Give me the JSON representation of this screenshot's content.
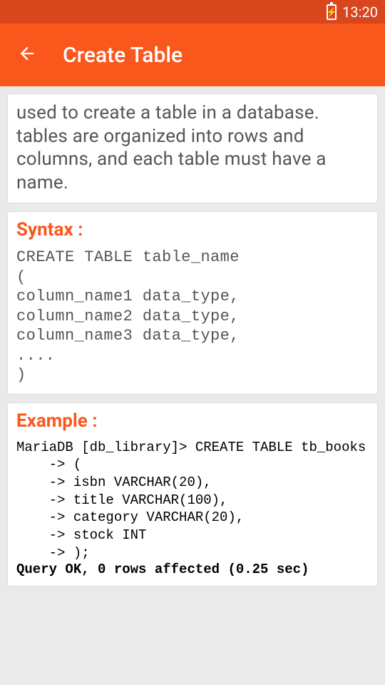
{
  "statusBar": {
    "time": "13:20"
  },
  "appBar": {
    "title": "Create Table"
  },
  "description": {
    "text": "used to create a table in a database. tables are organized into rows and columns, and each table must have a name."
  },
  "syntax": {
    "heading": "Syntax :",
    "code": "CREATE TABLE table_name\n(\ncolumn_name1 data_type,\ncolumn_name2 data_type,\ncolumn_name3 data_type,\n....\n)"
  },
  "example": {
    "heading": "Example :",
    "code": "MariaDB [db_library]> CREATE TABLE tb_books\n    -> (\n    -> isbn VARCHAR(20),\n    -> title VARCHAR(100),\n    -> category VARCHAR(20),\n    -> stock INT\n    -> );",
    "result": "Query OK, 0 rows affected (0.25 sec)"
  }
}
